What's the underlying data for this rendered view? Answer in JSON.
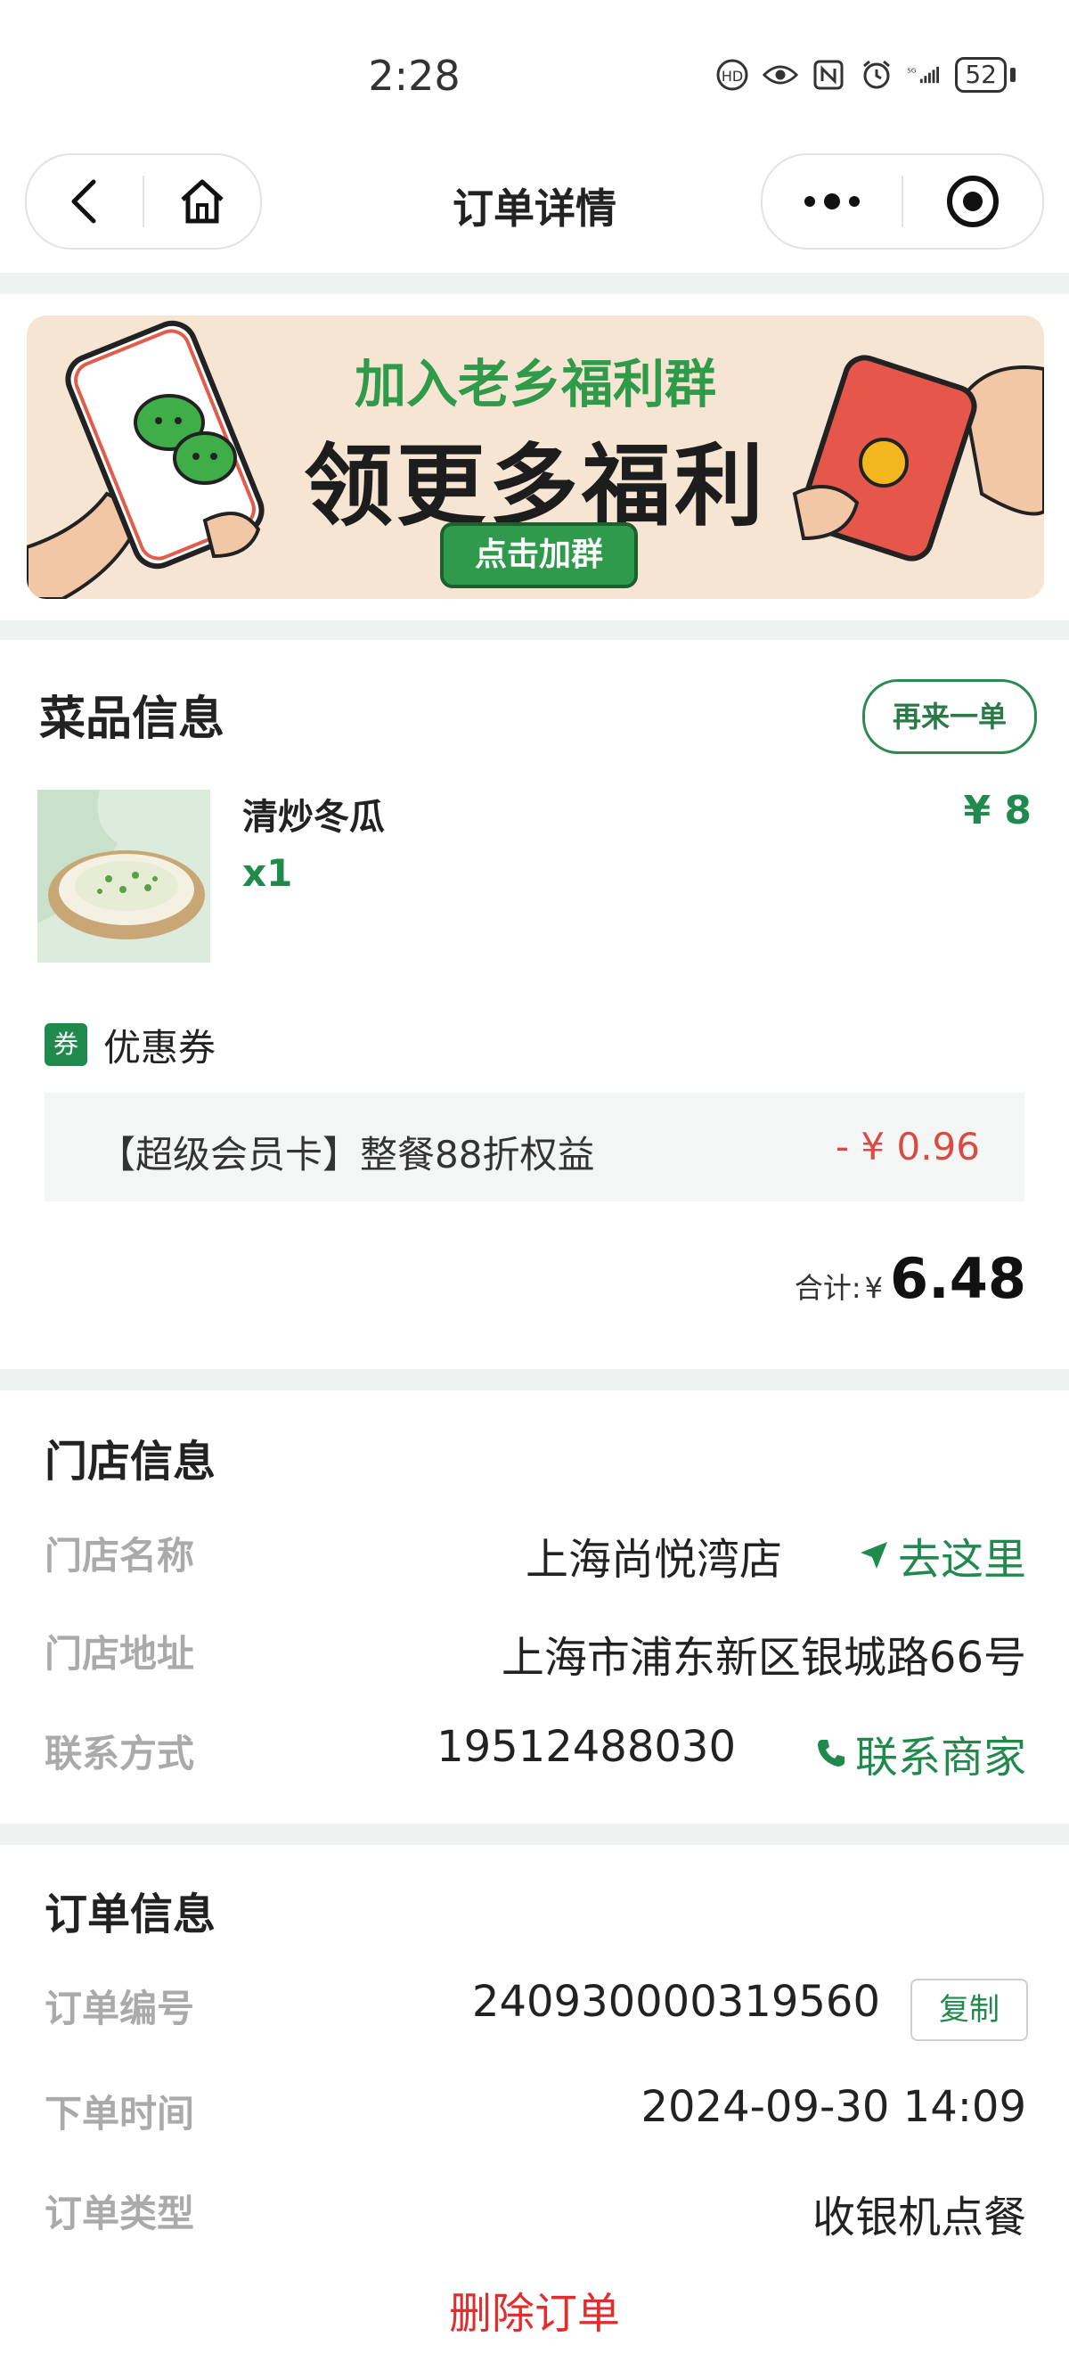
{
  "status_bar": {
    "time": "2:28",
    "battery": "52"
  },
  "nav": {
    "title": "订单详情"
  },
  "banner": {
    "subtitle": "加入老乡福利群",
    "headline": "领更多福利",
    "button": "点击加群"
  },
  "dish_section": {
    "title": "菜品信息",
    "reorder_button": "再来一单",
    "item": {
      "name": "清炒冬瓜",
      "quantity": "x1",
      "price": "¥ 8"
    },
    "coupon": {
      "tag": "券",
      "title": "优惠券",
      "description": "【超级会员卡】整餐88折权益",
      "amount": "- ¥ 0.96"
    },
    "total": {
      "label": "合计:",
      "currency": "¥",
      "amount": "6.48"
    }
  },
  "store_section": {
    "title": "门店信息",
    "name_label": "门店名称",
    "name_value": "上海尚悦湾店",
    "navigate": "去这里",
    "address_label": "门店地址",
    "address_value": "上海市浦东新区银城路66号",
    "contact_label": "联系方式",
    "contact_value": "19512488030",
    "call": "联系商家"
  },
  "order_section": {
    "title": "订单信息",
    "number_label": "订单编号",
    "number_value": "240930000319560",
    "copy": "复制",
    "time_label": "下单时间",
    "time_value": "2024-09-30 14:09",
    "type_label": "订单类型",
    "type_value": "收银机点餐"
  },
  "delete_button": "删除订单",
  "colors": {
    "accent": "#1f8a4c",
    "discount": "#d84a42",
    "delete": "#e02e2e",
    "separator": "#eef3f2"
  }
}
